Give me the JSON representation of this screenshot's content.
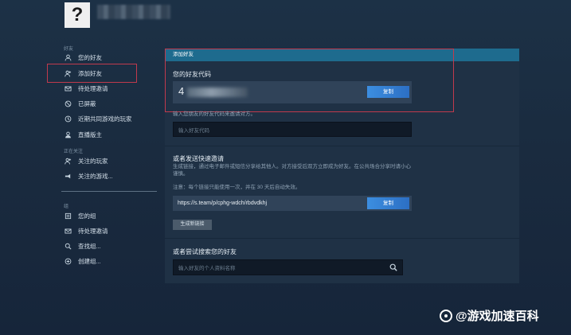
{
  "profile": {
    "avatar_glyph": "?",
    "username": "[blurred]"
  },
  "sidebar": {
    "friends_section": "好友",
    "friends_items": [
      {
        "label": "您的好友",
        "icon": "user-icon"
      },
      {
        "label": "添加好友",
        "icon": "add-user-icon"
      },
      {
        "label": "待处理邀请",
        "icon": "mail-icon"
      },
      {
        "label": "已屏蔽",
        "icon": "blocked-icon"
      },
      {
        "label": "近期共同游戏的玩家",
        "icon": "clock-icon"
      },
      {
        "label": "直播版主",
        "icon": "moderator-icon"
      }
    ],
    "following_section": "正在关注",
    "following_items": [
      {
        "label": "关注的玩家",
        "icon": "follow-user-icon"
      },
      {
        "label": "关注的游戏...",
        "icon": "game-icon"
      }
    ],
    "groups_section": "组",
    "groups_items": [
      {
        "label": "您的组",
        "icon": "group-icon"
      },
      {
        "label": "待处理邀请",
        "icon": "mail-icon"
      },
      {
        "label": "查找组...",
        "icon": "search-icon"
      },
      {
        "label": "创建组...",
        "icon": "plus-circle-icon"
      }
    ]
  },
  "panel": {
    "header": "添加好友",
    "code_title": "您的好友代码",
    "code_value": "4",
    "copy_label": "复制",
    "code_hint": "输入您朋友的好友代码来邀请对方。",
    "code_input_placeholder": "输入好友代码",
    "invite_title": "或者发送快速邀请",
    "invite_desc": "生成链接，通过电子邮件或短信分享给其他人。对方接受后双方立即成为好友。在公共场合分享时请小心谨慎。",
    "invite_note": "注意：每个链接只能使用一次，并在 30 天后自动失效。",
    "invite_link": "https://s.team/p/cphg-wdch/rbdvdkhj",
    "invite_copy_label": "复制",
    "generate_label": "生成新链接",
    "search_title": "或者尝试搜索您的好友",
    "search_placeholder": "输入好友的个人资料名称"
  },
  "watermark": {
    "text": "@游戏加速百科"
  }
}
